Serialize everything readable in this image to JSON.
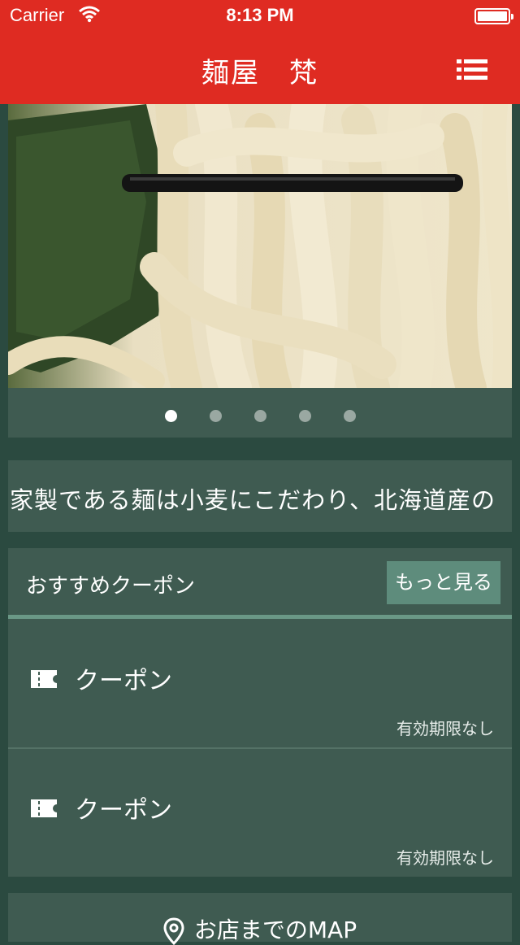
{
  "status_bar": {
    "carrier": "Carrier",
    "time": "8:13 PM"
  },
  "nav": {
    "title": "麺屋　梵"
  },
  "hero": {
    "pages": 5,
    "active_index": 0
  },
  "marquee": {
    "text": "家製である麺は小麦にこだわり、北海道産の"
  },
  "coupons": {
    "title": "おすすめクーポン",
    "more_label": "もっと見る",
    "items": [
      {
        "name": "クーポン",
        "expiry": "有効期限なし"
      },
      {
        "name": "クーポン",
        "expiry": "有効期限なし"
      }
    ]
  },
  "map": {
    "label": "お店までのMAP"
  },
  "colors": {
    "brand_red": "#df2b22",
    "card": "#3f5b51",
    "background": "#2b4a40",
    "accent": "#5e8c7c"
  }
}
